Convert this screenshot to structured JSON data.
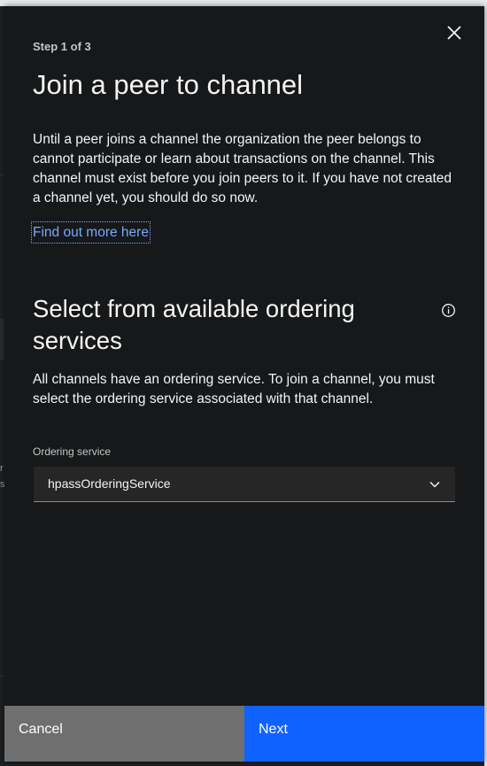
{
  "modal": {
    "step": "Step 1 of 3",
    "title": "Join a peer to channel",
    "intro": "Until a peer joins a channel the organization the peer belongs to cannot participate or learn about transactions on the channel. This channel must exist before you join peers to it. If you have not created a channel yet, you should do so now.",
    "link": "Find out more here",
    "close_icon": "close-icon"
  },
  "ordering": {
    "title": "Select from available ordering services",
    "description": "All channels have an ordering service. To join a channel, you must select the ordering service associated with that channel.",
    "info_icon": "info-icon",
    "field_label": "Ordering service",
    "selected": "hpassOrderingService",
    "chevron_icon": "chevron-down-icon"
  },
  "background": {
    "partial_text_1": "r",
    "partial_text_2": "s"
  },
  "footer": {
    "cancel": "Cancel",
    "next": "Next"
  },
  "colors": {
    "panel_bg": "#161819",
    "primary": "#0f62fe",
    "secondary": "#6f6f6f",
    "link": "#78a9ff"
  }
}
